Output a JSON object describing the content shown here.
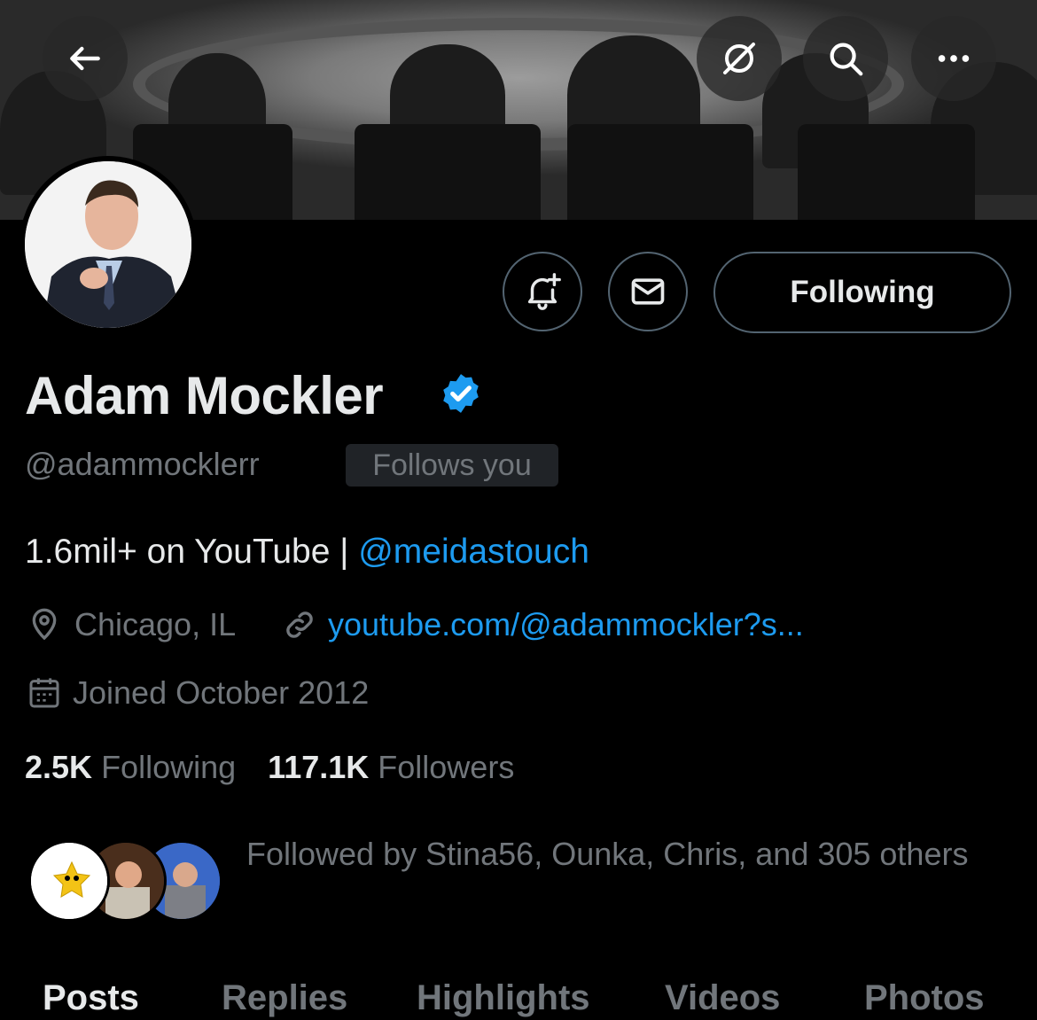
{
  "header": {
    "back_icon": "arrow-left-icon",
    "actions": [
      "translate-off-icon",
      "search-icon",
      "more-icon"
    ]
  },
  "profile": {
    "name": "Adam Mockler",
    "verified": true,
    "handle": "@adammocklerr",
    "follows_you_badge": "Follows you",
    "bio_text": "1.6mil+ on YouTube | ",
    "bio_mention": "@meidastouch",
    "location": "Chicago, IL",
    "website": "youtube.com/@adammockler?s...",
    "joined": "Joined October 2012",
    "following_count": "2.5K",
    "following_label": "Following",
    "followers_count": "117.1K",
    "followers_label": "Followers",
    "followed_by": "Followed by Stina56, Ounka, Chris, and 305 others"
  },
  "buttons": {
    "notify_icon": "bell-plus-icon",
    "message_icon": "mail-icon",
    "following_label": "Following"
  },
  "tabs": [
    {
      "label": "Posts",
      "active": true
    },
    {
      "label": "Replies",
      "active": false
    },
    {
      "label": "Highlights",
      "active": false
    },
    {
      "label": "Videos",
      "active": false
    },
    {
      "label": "Photos",
      "active": false
    }
  ],
  "colors": {
    "background": "#000000",
    "accent": "#1d9bf0",
    "muted": "#71767b"
  }
}
